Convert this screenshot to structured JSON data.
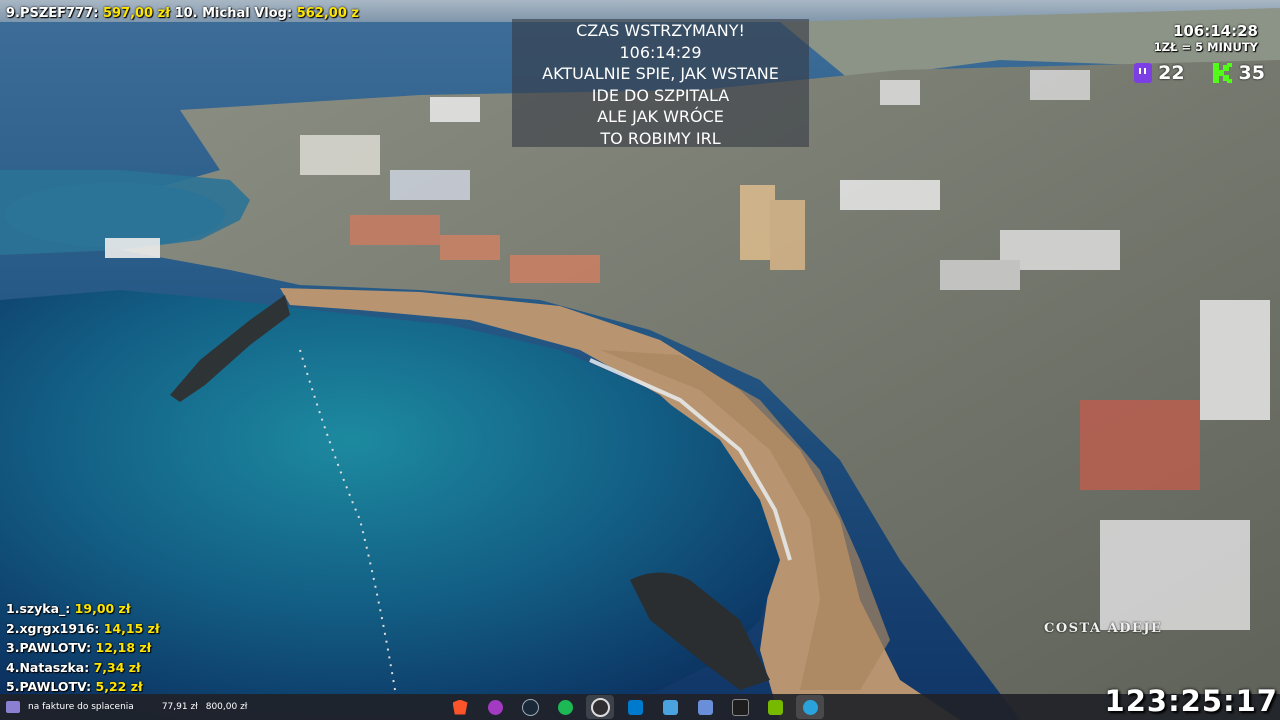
{
  "top_ticker": [
    {
      "rank": "9.",
      "name": "PSZEF777:",
      "amount": "597,00 zł"
    },
    {
      "rank": "10.",
      "name": "Michal Vlog:",
      "amount": "562,00 z"
    }
  ],
  "center_message": {
    "line1": "CZAS WSTRZYMANY!",
    "line2": "106:14:29",
    "line3": "AKTUALNIE SPIE, JAK WSTANE",
    "line4": "IDE DO SZPITALA",
    "line5": "ALE JAK WRÓCE",
    "line6": "TO ROBIMY IRL"
  },
  "top_right": {
    "timer": "106:14:28",
    "rate": "1ZŁ = 5 MINUTY",
    "twitch_count": "22",
    "kick_count": "35"
  },
  "leaderboard": [
    {
      "label": "1.szyka_:",
      "amount": "19,00 zł"
    },
    {
      "label": "2.xgrgx1916:",
      "amount": "14,15 zł"
    },
    {
      "label": "3.PAWLOTV:",
      "amount": "12,18 zł"
    },
    {
      "label": "4.Nataszka:",
      "amount": "7,34 zł"
    },
    {
      "label": "5.PAWLOTV:",
      "amount": "5,22 zł"
    }
  ],
  "location": "COSTA ADEJE",
  "big_timer": "123:25:17",
  "taskbar": {
    "widget_label": "na fakture do splacenia",
    "widget_current": "77,91 zł",
    "widget_goal": "800,00 zł",
    "apps": [
      {
        "icon": "brave-icon",
        "color": "#fb542b"
      },
      {
        "icon": "messenger-icon",
        "color": "#a33bc2"
      },
      {
        "icon": "steam-icon",
        "color": "#1b2838"
      },
      {
        "icon": "spotify-icon",
        "color": "#1db954"
      },
      {
        "icon": "obs-icon",
        "color": "#302e31"
      },
      {
        "icon": "vscode-icon",
        "color": "#007acc"
      },
      {
        "icon": "windows-tool-icon",
        "color": "#4aa3df"
      },
      {
        "icon": "network-tool-icon",
        "color": "#6a8fd8"
      },
      {
        "icon": "terminal-icon",
        "color": "#1e1e1e"
      },
      {
        "icon": "nvidia-icon",
        "color": "#76b900"
      },
      {
        "icon": "telegram-icon",
        "color": "#2aa3dd"
      }
    ]
  },
  "colors": {
    "amount": "#ffe600",
    "twitch": "#7b3fe4",
    "kick": "#53fc18"
  }
}
